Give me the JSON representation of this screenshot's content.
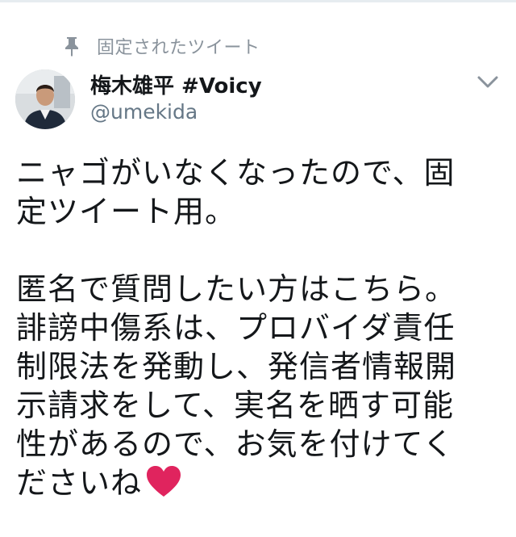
{
  "pinned": {
    "label": "固定されたツイート",
    "icon": "pin-icon"
  },
  "author": {
    "display_name": "梅木雄平 #Voicy",
    "handle": "@umekida"
  },
  "menu": {
    "icon": "chevron-down-icon"
  },
  "tweet": {
    "lines": [
      "ニャゴがいなくなったので、固",
      "定ツイート用。",
      "",
      "匿名で質問したい方はこちら。",
      "誹謗中傷系は、プロバイダ責任",
      "制限法を発動し、発信者情報開",
      "示請求をして、実名を晒す可能",
      "性があるので、お気を付けてく",
      "ださいね"
    ],
    "emoji": "red-heart"
  },
  "colors": {
    "text": "#14171a",
    "secondary": "#657786",
    "pinned_label": "#8a939c",
    "heart": "#e0245e"
  }
}
